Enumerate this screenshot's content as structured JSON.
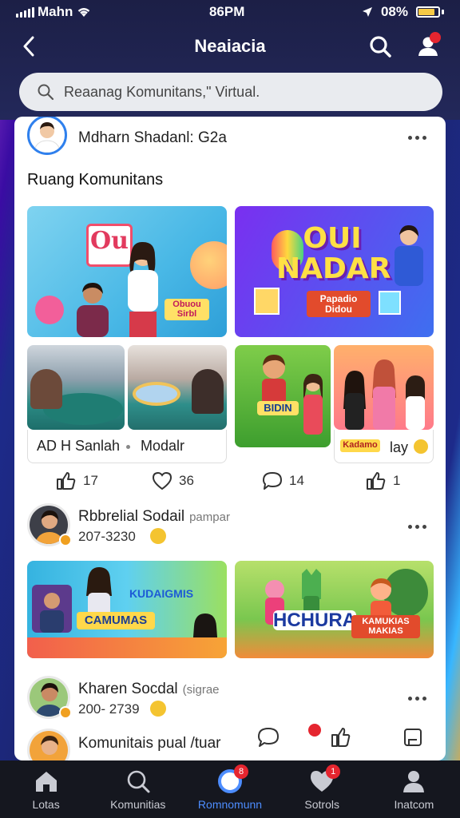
{
  "status_bar": {
    "carrier": "Mahn",
    "time": "86PM",
    "battery": "08%"
  },
  "nav": {
    "title": "Neaiacia"
  },
  "search": {
    "text": "Reaanag Komunitans,\" Virtual."
  },
  "post1": {
    "author": "Mdharn Shadanl: G2a",
    "section_title": "Ruang Komunitans",
    "card_a_text": "Ou",
    "card_a_badge": "Obuou Sirbl",
    "card_b_text": "OUI NADAR",
    "card_b_badge": "Papadio Didou",
    "card_e_badge": "BIDIN",
    "chip_left_label": "AD H Sanlah",
    "chip_left_label2": "Modalr",
    "chip_right_badge": "Kadamo",
    "chip_right_label": "lay",
    "reactions": [
      {
        "icon": "thumbs-up-icon",
        "count": "17"
      },
      {
        "icon": "heart-icon",
        "count": "36"
      },
      {
        "icon": "comment-icon",
        "count": "14"
      },
      {
        "icon": "thumbs-up-icon",
        "count": "1"
      }
    ]
  },
  "post2": {
    "author": "Rbbrelial Sodail",
    "author_sub": "pampar",
    "meta": "207-3230",
    "card_left_title": "KUDAIGMIS",
    "card_left_badge": "CAMUMAS",
    "card_right_title": "HCHURA",
    "card_right_badge": "KAMUKIAS MAKIAS"
  },
  "post3": {
    "author": "Kharen Socdal",
    "author_sub": "(sigrae",
    "meta": "200- 2739"
  },
  "post4": {
    "author": "Komunitais pual /tuar"
  },
  "bottom_nav": {
    "tabs": [
      {
        "label": "Lotas",
        "icon": "home-icon",
        "badge": ""
      },
      {
        "label": "Komunitias",
        "icon": "search-icon",
        "badge": ""
      },
      {
        "label": "Romnomunn",
        "icon": "community-icon",
        "badge": "8"
      },
      {
        "label": "Sotrols",
        "icon": "heart-icon",
        "badge": "1"
      },
      {
        "label": "Inatcom",
        "icon": "profile-icon",
        "badge": ""
      }
    ]
  },
  "colors": {
    "accent": "#4d8dff",
    "notification": "#e5252f",
    "header_bg": "#1c1f46"
  }
}
